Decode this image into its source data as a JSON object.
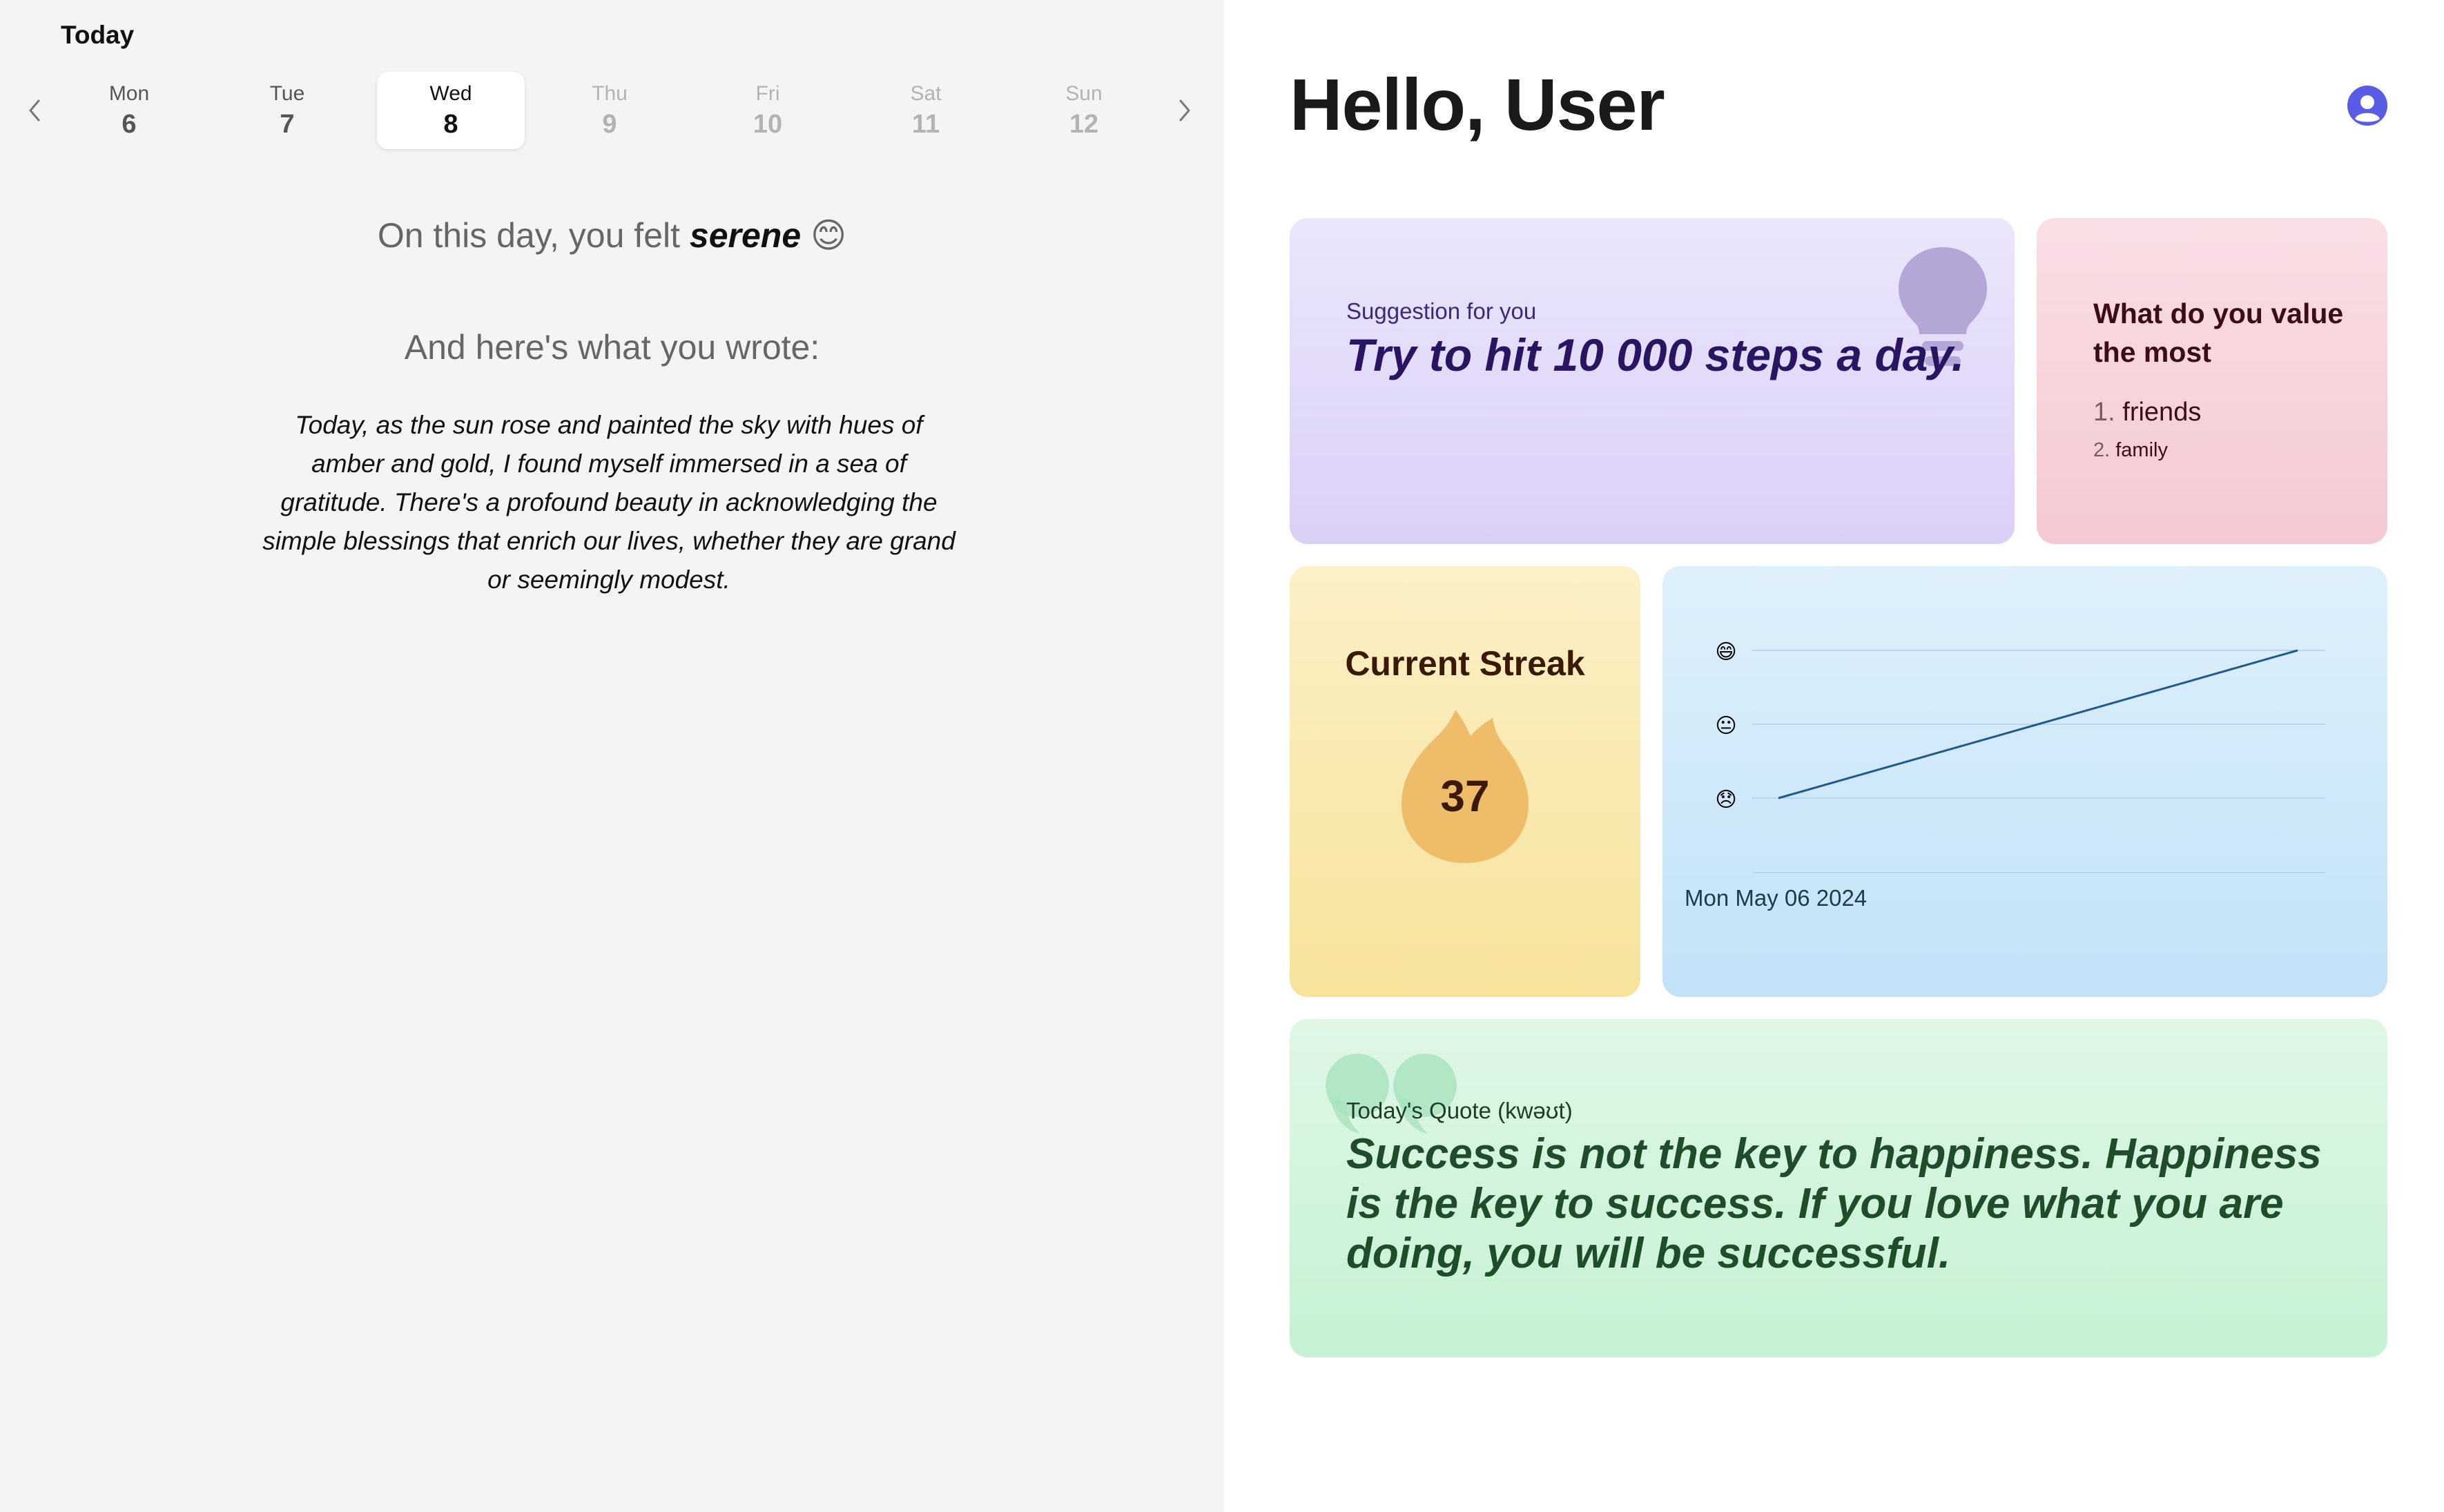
{
  "left": {
    "title": "Today",
    "days": [
      {
        "name": "Mon",
        "num": "6"
      },
      {
        "name": "Tue",
        "num": "7"
      },
      {
        "name": "Wed",
        "num": "8"
      },
      {
        "name": "Thu",
        "num": "9"
      },
      {
        "name": "Fri",
        "num": "10"
      },
      {
        "name": "Sat",
        "num": "11"
      },
      {
        "name": "Sun",
        "num": "12"
      }
    ],
    "selected_day": "Wed",
    "felt_prefix": "On this day, you felt",
    "mood": "serene",
    "mood_emoji": "😊",
    "wrote_heading": "And here's what you wrote:",
    "entry": "Today, as the sun rose and painted the sky with hues of amber and gold, I found myself immersed in a sea of gratitude. There's a profound beauty in acknowledging the simple blessings that enrich our lives, whether they are grand or seemingly modest."
  },
  "header": {
    "greeting": "Hello, User",
    "avatar_icon": "user-avatar-icon",
    "avatar_color": "#5b5ce6"
  },
  "suggestion": {
    "label": "Suggestion for you",
    "text": "Try to hit 10 000 steps a day.",
    "icon": "lightbulb-icon"
  },
  "values": {
    "question": "What do you value the most",
    "items": [
      {
        "num": "1.",
        "label": "friends"
      },
      {
        "num": "2.",
        "label": "family"
      }
    ]
  },
  "streak": {
    "title": "Current Streak",
    "count": "37",
    "icon": "flame-icon"
  },
  "mood_chart": {
    "date_label": "Mon May 06 2024"
  },
  "chart_data": {
    "type": "line",
    "y_levels": [
      "😞",
      "😐",
      "😄"
    ],
    "series": [
      {
        "values": [
          0,
          2
        ]
      }
    ],
    "ylim": [
      0,
      2
    ],
    "grid": true,
    "line_color": "#1f5a8a"
  },
  "quote": {
    "label": "Today's Quote (kwəʊt)",
    "text": "Success is not the key to happiness. Happiness is the key to success. If you love what you are doing, you will be successful.",
    "icon": "quote-marks-icon"
  }
}
